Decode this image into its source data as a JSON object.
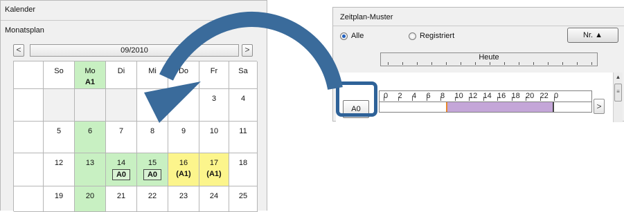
{
  "kalender": {
    "title": "Kalender",
    "subtitle": "Monatsplan",
    "prev_label": "<",
    "next_label": ">",
    "month": "09/2010",
    "weekdays": [
      {
        "day": "So",
        "code": ""
      },
      {
        "day": "Mo",
        "code": "A1"
      },
      {
        "day": "Di",
        "code": ""
      },
      {
        "day": "Mi",
        "code": ""
      },
      {
        "day": "Do",
        "code": ""
      },
      {
        "day": "Fr",
        "code": ""
      },
      {
        "day": "Sa",
        "code": ""
      }
    ],
    "weeks": [
      [
        {
          "day": "",
          "code": "",
          "style": "grey"
        },
        {
          "day": "",
          "code": "",
          "style": "grey"
        },
        {
          "day": "",
          "code": "",
          "style": "grey"
        },
        {
          "day": "1",
          "code": "",
          "style": ""
        },
        {
          "day": "",
          "code": "",
          "style": ""
        },
        {
          "day": "3",
          "code": "",
          "style": ""
        },
        {
          "day": "4",
          "code": "",
          "style": ""
        }
      ],
      [
        {
          "day": "5",
          "code": "",
          "style": ""
        },
        {
          "day": "6",
          "code": "",
          "style": "green"
        },
        {
          "day": "7",
          "code": "",
          "style": ""
        },
        {
          "day": "8",
          "code": "",
          "style": ""
        },
        {
          "day": "9",
          "code": "",
          "style": ""
        },
        {
          "day": "10",
          "code": "",
          "style": ""
        },
        {
          "day": "11",
          "code": "",
          "style": ""
        }
      ],
      [
        {
          "day": "12",
          "code": "",
          "style": ""
        },
        {
          "day": "13",
          "code": "",
          "style": "green"
        },
        {
          "day": "14",
          "code": "A0",
          "style": "green",
          "boxed": true
        },
        {
          "day": "15",
          "code": "A0",
          "style": "green",
          "boxed": true
        },
        {
          "day": "16",
          "code": "(A1)",
          "style": "yellow"
        },
        {
          "day": "17",
          "code": "(A1)",
          "style": "yellow"
        },
        {
          "day": "18",
          "code": "",
          "style": ""
        }
      ],
      [
        {
          "day": "19",
          "code": "",
          "style": ""
        },
        {
          "day": "20",
          "code": "",
          "style": "green"
        },
        {
          "day": "21",
          "code": "",
          "style": ""
        },
        {
          "day": "22",
          "code": "",
          "style": ""
        },
        {
          "day": "23",
          "code": "",
          "style": ""
        },
        {
          "day": "24",
          "code": "",
          "style": ""
        },
        {
          "day": "25",
          "code": "",
          "style": ""
        }
      ]
    ]
  },
  "zeitplan": {
    "title": "Zeitplan-Muster",
    "filter_all": "Alle",
    "filter_registered": "Registriert",
    "filter_selected": "Alle",
    "sort_button": "Nr. ▲",
    "ruler_label": "Heute",
    "pattern_button": "A0",
    "hours": [
      "0",
      "2",
      "4",
      "6",
      "8",
      "10",
      "12",
      "14",
      "16",
      "18",
      "20",
      "22",
      "0"
    ],
    "timeline_next": ">",
    "colors": {
      "bar": "#c4a6d8",
      "marker": "#e8892a",
      "arrow": "#3a6b9b",
      "highlight": "#2e6298"
    }
  }
}
